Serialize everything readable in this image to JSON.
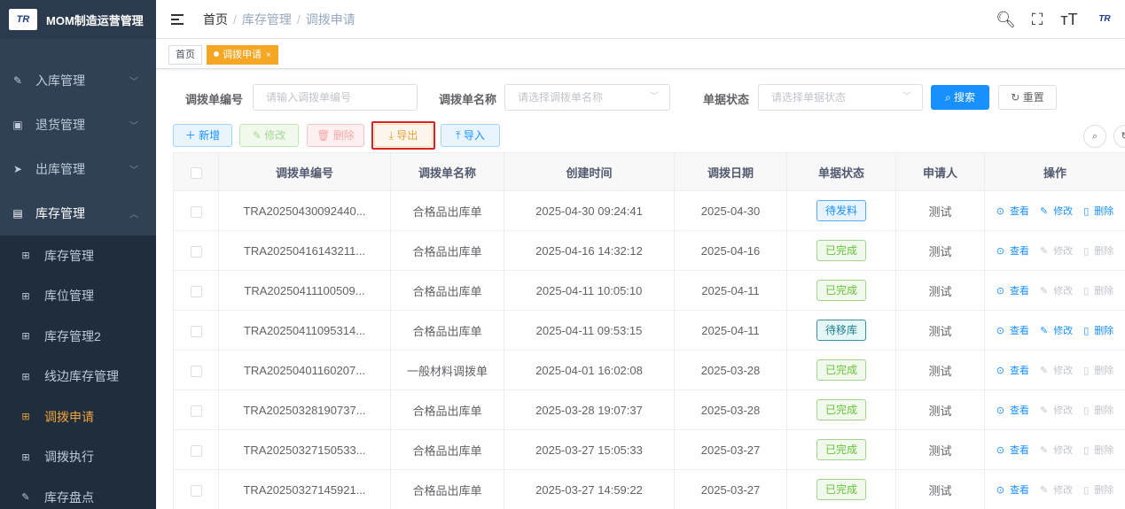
{
  "sidebar": {
    "logo_text": "TR",
    "app_title": "MOM制造运营管理",
    "menus": [
      {
        "label": "入库管理",
        "icon": "edit-icon"
      },
      {
        "label": "退货管理",
        "icon": "box-icon"
      },
      {
        "label": "出库管理",
        "icon": "send-icon"
      },
      {
        "label": "库存管理",
        "icon": "monitor-icon"
      }
    ],
    "submenu": [
      {
        "label": "库存管理"
      },
      {
        "label": "库位管理"
      },
      {
        "label": "库存管理2"
      },
      {
        "label": "线边库存管理"
      },
      {
        "label": "调拨申请"
      },
      {
        "label": "调拨执行"
      },
      {
        "label": "库存盘点"
      }
    ]
  },
  "header": {
    "breadcrumb": [
      "首页",
      "库存管理",
      "调拨申请"
    ],
    "logo_text": "TR"
  },
  "tags": {
    "home": "首页",
    "active": "调拨申请"
  },
  "search": {
    "code_label": "调拨单编号",
    "code_placeholder": "请输入调拨单编号",
    "name_label": "调拨单名称",
    "name_placeholder": "请选择调拨单名称",
    "status_label": "单据状态",
    "status_placeholder": "请选择单据状态",
    "search_btn": "搜索",
    "reset_btn": "重置"
  },
  "toolbar": {
    "add": "新增",
    "edit": "修改",
    "delete": "删除",
    "export": "导出",
    "import": "导入"
  },
  "table": {
    "columns": [
      "调拨单编号",
      "调拨单名称",
      "创建时间",
      "调拨日期",
      "单据状态",
      "申请人",
      "操作"
    ],
    "ops": {
      "view": "查看",
      "edit": "修改",
      "delete": "删除"
    },
    "rows": [
      {
        "code": "TRA20250430092440...",
        "name": "合格品出库单",
        "created": "2025-04-30 09:24:41",
        "date": "2025-04-30",
        "status": "待发料",
        "status_type": "blue",
        "applicant": "测试",
        "editable": true
      },
      {
        "code": "TRA20250416143211...",
        "name": "合格品出库单",
        "created": "2025-04-16 14:32:12",
        "date": "2025-04-16",
        "status": "已完成",
        "status_type": "green",
        "applicant": "测试",
        "editable": false
      },
      {
        "code": "TRA20250411100509...",
        "name": "合格品出库单",
        "created": "2025-04-11 10:05:10",
        "date": "2025-04-11",
        "status": "已完成",
        "status_type": "green",
        "applicant": "测试",
        "editable": false
      },
      {
        "code": "TRA20250411095314...",
        "name": "合格品出库单",
        "created": "2025-04-11 09:53:15",
        "date": "2025-04-11",
        "status": "待移库",
        "status_type": "cyan",
        "applicant": "测试",
        "editable": true
      },
      {
        "code": "TRA20250401160207...",
        "name": "一般材料调拨单",
        "created": "2025-04-01 16:02:08",
        "date": "2025-03-28",
        "status": "已完成",
        "status_type": "green",
        "applicant": "测试",
        "editable": false
      },
      {
        "code": "TRA20250328190737...",
        "name": "合格品出库单",
        "created": "2025-03-28 19:07:37",
        "date": "2025-03-28",
        "status": "已完成",
        "status_type": "green",
        "applicant": "测试",
        "editable": false
      },
      {
        "code": "TRA20250327150533...",
        "name": "合格品出库单",
        "created": "2025-03-27 15:05:33",
        "date": "2025-03-27",
        "status": "已完成",
        "status_type": "green",
        "applicant": "测试",
        "editable": false
      },
      {
        "code": "TRA20250327145921...",
        "name": "合格品出库单",
        "created": "2025-03-27 14:59:22",
        "date": "2025-03-27",
        "status": "已完成",
        "status_type": "green",
        "applicant": "测试",
        "editable": false
      }
    ]
  }
}
